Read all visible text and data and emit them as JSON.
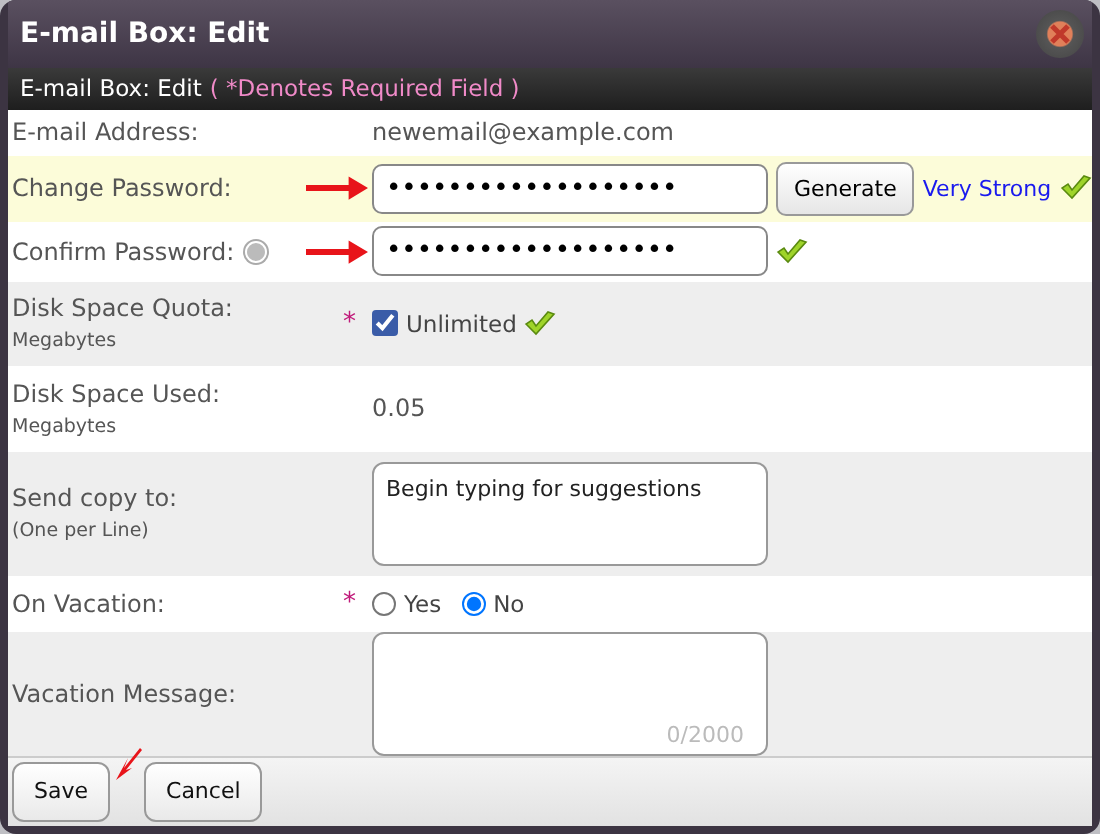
{
  "window": {
    "title": "E-mail Box: Edit"
  },
  "subheader": {
    "title": "E-mail Box: Edit",
    "note": "( *Denotes Required Field )"
  },
  "rows": [
    {
      "kind": "text",
      "label": "E-mail Address:",
      "value": "newemail@example.com",
      "highlighted": false
    },
    {
      "kind": "password",
      "label": "Change Password:",
      "value": "•••••••••••••••••••",
      "highlighted": true,
      "arrow": true,
      "button": "Generate",
      "strength": "Very Strong",
      "valid": true
    },
    {
      "kind": "password",
      "label": "Confirm Password:",
      "help": true,
      "value": "•••••••••••••••••••",
      "highlighted": false,
      "arrow": true,
      "valid": true
    },
    {
      "kind": "checkbox",
      "label": "Disk Space Quota:",
      "sublabel": "Megabytes",
      "required_mark": "*",
      "option": "Unlimited",
      "checked": true,
      "valid": true,
      "highlighted": false
    },
    {
      "kind": "text",
      "label": "Disk Space Used:",
      "sublabel": "Megabytes",
      "value": "0.05",
      "highlighted": false
    },
    {
      "kind": "textarea",
      "label": "Send copy to:",
      "sublabel": "(One per Line)",
      "placeholder": "Begin typing for suggestions",
      "highlighted": false
    },
    {
      "kind": "radio",
      "label": "On Vacation:",
      "required_mark": "*",
      "options": [
        {
          "label": "Yes",
          "selected": false
        },
        {
          "label": "No",
          "selected": true
        }
      ],
      "highlighted": false
    },
    {
      "kind": "textarea",
      "label": "Vacation Message:",
      "counter": "0/2000",
      "highlighted": false
    }
  ],
  "buttons": [
    {
      "label": "Save",
      "arrow": true
    },
    {
      "label": "Cancel"
    }
  ]
}
